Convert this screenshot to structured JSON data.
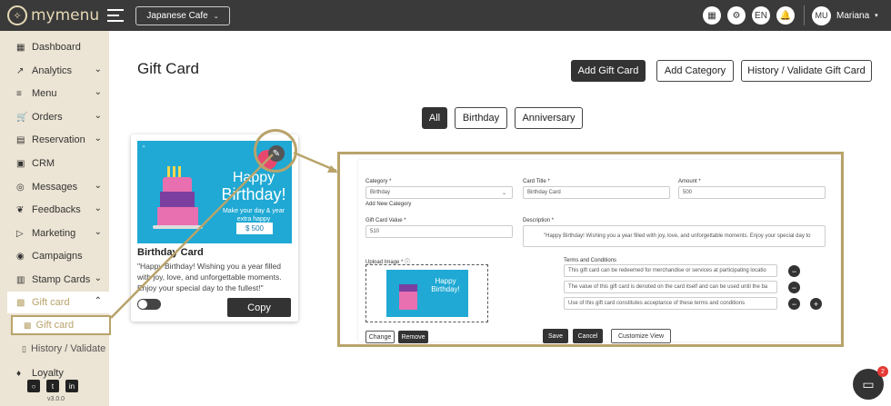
{
  "app": {
    "logo_text": "mymenu",
    "store": "Japanese Cafe"
  },
  "topbar": {
    "lang": "EN",
    "user_initials": "MU",
    "user_name": "Mariana"
  },
  "sidebar": {
    "items": [
      {
        "label": "Dashboard",
        "icon": "speedometer-icon"
      },
      {
        "label": "Analytics",
        "icon": "chart-line-icon"
      },
      {
        "label": "Menu",
        "icon": "list-icon"
      },
      {
        "label": "Orders",
        "icon": "cart-icon"
      },
      {
        "label": "Reservation",
        "icon": "calendar-icon"
      },
      {
        "label": "CRM",
        "icon": "id-card-icon"
      },
      {
        "label": "Messages",
        "icon": "chat-icon"
      },
      {
        "label": "Feedbacks",
        "icon": "feedback-icon"
      },
      {
        "label": "Marketing",
        "icon": "megaphone-icon"
      },
      {
        "label": "Campaigns",
        "icon": "target-icon"
      },
      {
        "label": "Stamp Cards",
        "icon": "stamp-icon"
      },
      {
        "label": "Gift card",
        "icon": "gift-icon"
      }
    ],
    "sub_items": [
      "Gift card",
      "History / Validate"
    ],
    "loyalty": "Loyalty",
    "version": "v3.0.0"
  },
  "page": {
    "title": "Gift Card",
    "add_gift_card": "Add Gift Card",
    "add_category": "Add Category",
    "history_validate": "History / Validate Gift Card",
    "filters": [
      "All",
      "Birthday",
      "Anniversary"
    ]
  },
  "card": {
    "title": "Birthday Card",
    "description": "\"Happy Birthday! Wishing you a year filled with joy, love, and unforgettable moments. Enjoy your special day to the fullest!\"",
    "image_line1": "Happy",
    "image_line2": "Birthday!",
    "image_line3": "Make your day & year extra happy",
    "image_price": "$ 500",
    "copy": "Copy"
  },
  "form": {
    "category_label": "Category *",
    "category_value": "Birthday",
    "add_new_category": "Add New Category",
    "card_title_label": "Card Title *",
    "card_title_value": "Birthday Card",
    "amount_label": "Amount *",
    "amount_value": "500",
    "value_label": "Gift Card Value *",
    "value_value": "510",
    "description_label": "Description *",
    "description_value": "\"Happy Birthday! Wishing you a year filled with joy, love, and unforgettable moments. Enjoy your special day to",
    "upload_label": "Upload Image *",
    "terms_label": "Terms and Conditions",
    "terms": [
      "This gift card can be redeemed for merchandise or services at participating locatio",
      "The value of this gift card is denoted on the card itself and can be used until the ba",
      "Use of this gift card constitutes acceptance of these terms and conditions"
    ],
    "change": "Change",
    "remove": "Remove",
    "save": "Save",
    "cancel": "Cancel",
    "customize": "Customize View"
  },
  "chat_badge": "2"
}
